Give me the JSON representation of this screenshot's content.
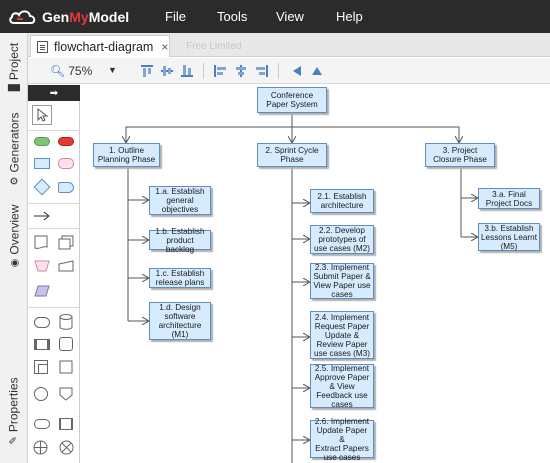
{
  "app": {
    "logo_text_prefix": "Gen",
    "logo_text_accent": "My",
    "logo_text_suffix": "Model",
    "menu": [
      "File",
      "Tools",
      "View",
      "Help"
    ]
  },
  "side_tabs": {
    "project": "Project",
    "generators": "Generators",
    "overview": "Overview",
    "properties": "Properties"
  },
  "tabs": {
    "active_label": "flowchart-diagram",
    "close_glyph": "×",
    "ghost_label": "Free Limited"
  },
  "toolbar": {
    "zoom_label": "75%",
    "zoom_caret": "▼"
  },
  "palette": {
    "header_arrow": "➡"
  },
  "diagram": {
    "root": "Conference\nPaper System",
    "phases": [
      "1. Outline\nPlanning Phase",
      "2. Sprint Cycle\nPhase",
      "3. Project\nClosure Phase"
    ],
    "phase1_tasks": [
      "1.a. Establish\ngeneral\nobjectives",
      "1.b. Establish\nproduct backlog",
      "1.c. Establish\nrelease plans",
      "1.d. Design\nsoftware\narchitecture\n(M1)"
    ],
    "phase2_tasks": [
      "2.1. Establish\narchitecture",
      "2.2. Develop\nprototypes of\nuse cases (M2)",
      "2.3. Implement\nSubmit Paper &\nView Paper use\ncases",
      "2.4. Implement\nRequest Paper\nUpdate &\nReview Paper\nuse cases (M3)",
      "2.5. Implement\nApprove Paper\n& View\nFeedback use\ncases",
      "2.6. Implement\nUpdate Paper &\nExtract Papers\nuse cases"
    ],
    "phase3_tasks": [
      "3.a. Final\nProject Docs",
      "3.b. Establish\nLessons Learnt\n(M5)"
    ]
  },
  "colors": {
    "topbar": "#2b2b2b",
    "node_fill": "#d7ebff",
    "node_border": "#5f8fc0",
    "accent": "#e53935"
  }
}
